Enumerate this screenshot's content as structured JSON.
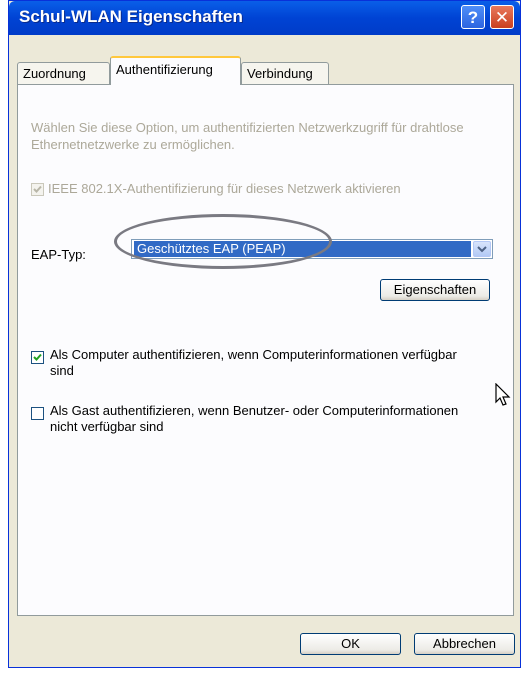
{
  "window": {
    "title": "Schul-WLAN Eigenschaften"
  },
  "tabs": [
    {
      "label": "Zuordnung",
      "active": false
    },
    {
      "label": "Authentifizierung",
      "active": true
    },
    {
      "label": "Verbindung",
      "active": false
    }
  ],
  "auth": {
    "description": "Wählen Sie diese Option, um authentifizierten Netzwerkzugriff für drahtlose Ethernetnetzwerke zu ermöglichen.",
    "ieee_label": "IEEE 802.1X-Authentifizierung für dieses Netzwerk aktivieren",
    "ieee_checked": true,
    "eap_label": "EAP-Typ:",
    "eap_value": "Geschütztes EAP (PEAP)",
    "properties_button": "Eigenschaften",
    "computer_auth_label": "Als Computer authentifizieren, wenn Computerinformationen verfügbar sind",
    "computer_auth_checked": true,
    "guest_auth_label": "Als Gast authentifizieren, wenn Benutzer- oder Computerinformationen nicht verfügbar sind",
    "guest_auth_checked": false
  },
  "buttons": {
    "ok": "OK",
    "cancel": "Abbrechen"
  },
  "icons": [
    "help-icon",
    "close-icon",
    "checkmark-icon",
    "dropdown-arrow-icon",
    "mouse-cursor-icon"
  ]
}
